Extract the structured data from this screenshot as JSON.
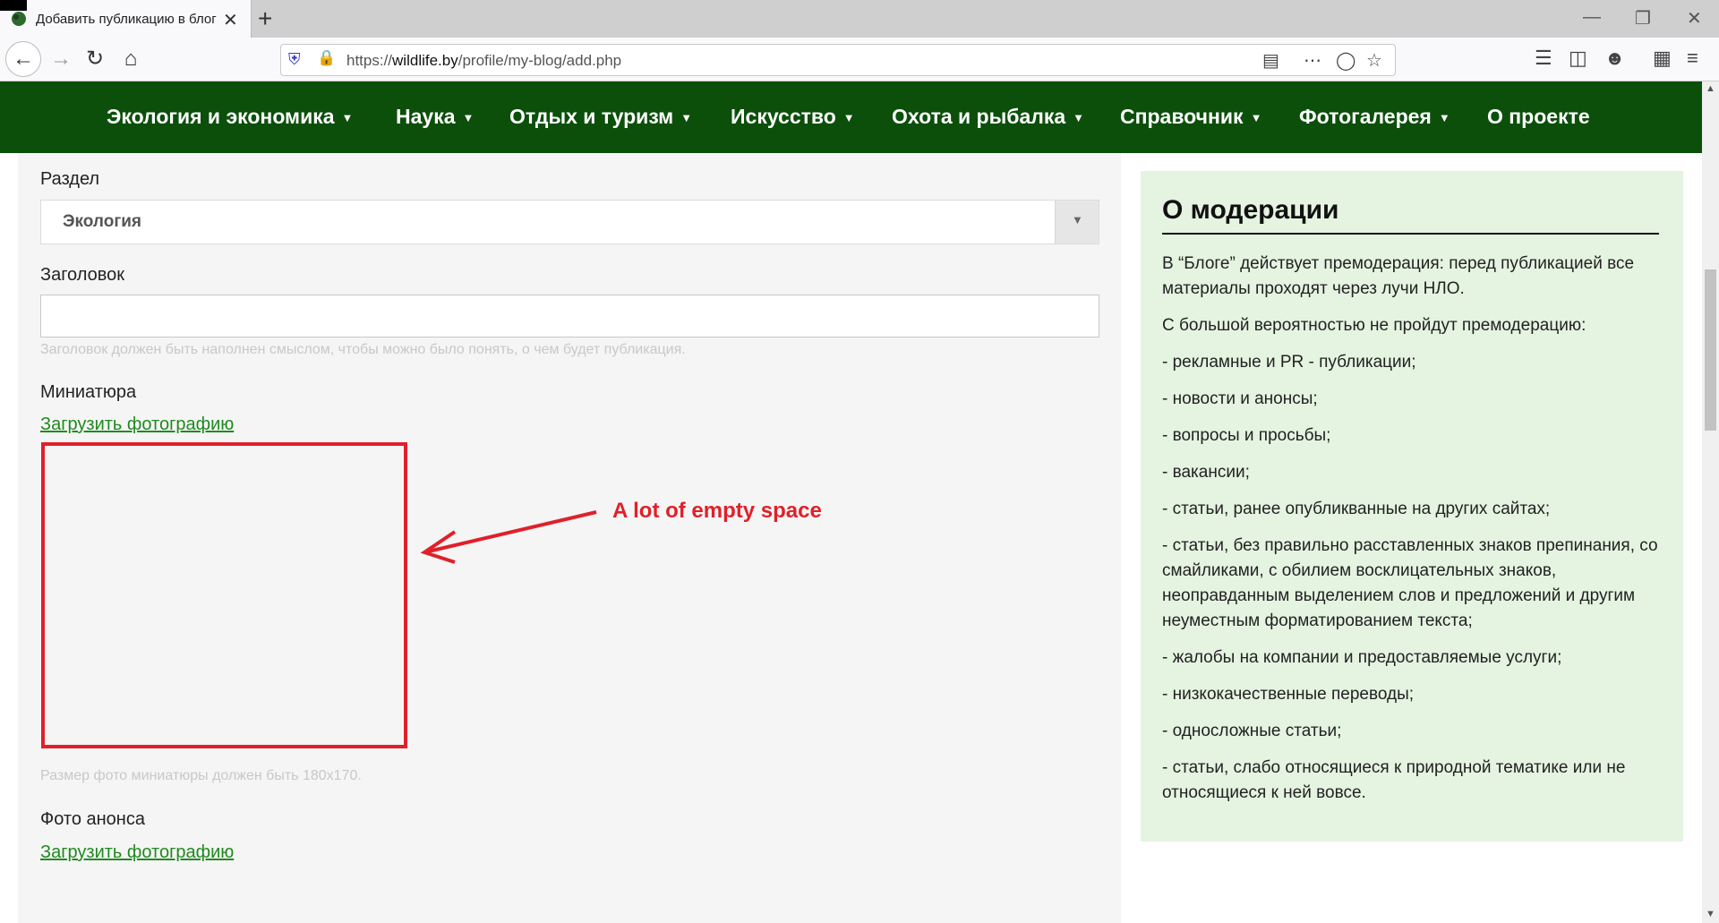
{
  "browser": {
    "tab_title": "Добавить публикацию в блог",
    "tab_close": "✕",
    "new_tab": "+",
    "url_domain": "wildlife.by",
    "url_prefix": "https://",
    "url_path": "/profile/my-blog/add.php",
    "window_controls": [
      "—",
      "❐",
      "✕"
    ]
  },
  "site_nav": {
    "items": [
      {
        "label": "Экология и экономика",
        "has_dropdown": true
      },
      {
        "label": "Наука",
        "has_dropdown": true
      },
      {
        "label": "Отдых и туризм",
        "has_dropdown": true
      },
      {
        "label": "Искусство",
        "has_dropdown": true
      },
      {
        "label": "Охота и рыбалка",
        "has_dropdown": true
      },
      {
        "label": "Справочник",
        "has_dropdown": true
      },
      {
        "label": "Фотогалерея",
        "has_dropdown": true
      },
      {
        "label": "О проекте",
        "has_dropdown": false
      }
    ],
    "caret": "▼",
    "bg_color": "#0b4f0b"
  },
  "form": {
    "section_label": "Раздел",
    "section_value": "Экология",
    "title_label": "Заголовок",
    "title_value": "",
    "title_hint": "Заголовок должен быть наполнен смыслом, чтобы можно было понять, о чем будет публикация.",
    "thumbnail_label": "Миниатюра",
    "thumbnail_upload": "Загрузить фотографию",
    "thumbnail_hint": "Размер фото миниатюры должен быть 180x170.",
    "announce_label": "Фото анонса",
    "announce_upload": "Загрузить фотографию"
  },
  "annotation": {
    "text": "A lot of empty space",
    "color": "#e0202a"
  },
  "moderation": {
    "title": "О модерации",
    "paragraphs": [
      "В “Блоге” действует премодерация: перед публикацией все материалы проходят через лучи НЛО.",
      "С большой вероятностью не пройдут премодерацию:",
      "- рекламные и PR - публикации;",
      "- новости и анонсы;",
      "- вопросы и просьбы;",
      "- вакансии;",
      "- статьи, ранее опубликванные на других сайтах;",
      "- статьи, без правильно расставленных знаков препинания, со смайликами, с обилием восклицательных знаков, неоправданным выделением слов и предложений и другим неуместным форматированием текста;",
      "- жалобы на компании и предоставляемые услуги;",
      "- низкокачественные переводы;",
      "- односложные статьи;",
      "- статьи, слабо относящиеся к природной тематике или не относящиеся к ней вовсе."
    ],
    "bg_color": "#e5f3e1"
  }
}
